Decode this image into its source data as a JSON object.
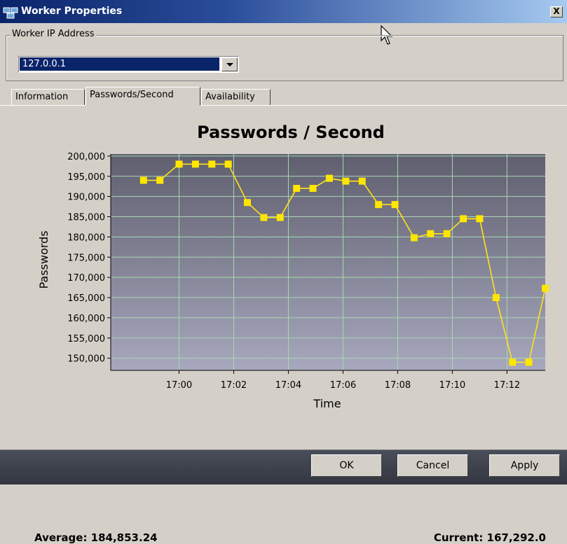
{
  "window": {
    "title": "Worker Properties",
    "close_label": "X"
  },
  "ip_group": {
    "label": "Worker IP Address",
    "selected": "127.0.0.1"
  },
  "tabs": [
    {
      "label": "Information",
      "active": false
    },
    {
      "label": "Passwords/Second",
      "active": true
    },
    {
      "label": "Availability",
      "active": false
    }
  ],
  "stats": {
    "average": "Average: 184,853.24",
    "current": "Current: 167,292.0"
  },
  "buttons": {
    "ok": "OK",
    "cancel": "Cancel",
    "apply": "Apply"
  },
  "colors": {
    "line": "#ffe21a",
    "marker": "#ffe600",
    "grid": "#a8d8b0",
    "plot_top": "#5f5f6f",
    "plot_bottom": "#a7a7bd"
  },
  "chart_data": {
    "type": "line",
    "title": "Passwords / Second",
    "xlabel": "Time",
    "ylabel": "Passwords",
    "ylim": [
      147000,
      200500
    ],
    "y_ticks": [
      "150,000",
      "155,000",
      "160,000",
      "165,000",
      "170,000",
      "175,000",
      "180,000",
      "185,000",
      "190,000",
      "195,000",
      "200,000"
    ],
    "x_ticks": [
      "17:00",
      "17:02",
      "17:04",
      "17:06",
      "17:08",
      "17:10",
      "17:12"
    ],
    "series": [
      {
        "values": [
          [
            16.98,
            194000
          ],
          [
            16.98,
            194000
          ]
        ]
      }
    ],
    "x": [
      "16:58.7",
      "16:59.3",
      "17:00.0",
      "17:00.6",
      "17:01.2",
      "17:01.8",
      "17:02.5",
      "17:03.1",
      "17:03.7",
      "17:04.3",
      "17:04.9",
      "17:05.5",
      "17:06.1",
      "17:06.7",
      "17:07.3",
      "17:07.9",
      "17:08.6",
      "17:09.2",
      "17:09.8",
      "17:10.4",
      "17:11.0",
      "17:11.6",
      "17:12.2",
      "17:12.8",
      "17:13.4"
    ],
    "y": [
      194000,
      194000,
      198000,
      198000,
      198000,
      198000,
      188500,
      184800,
      184800,
      192000,
      192000,
      194500,
      193800,
      193800,
      188000,
      188000,
      179800,
      180800,
      180800,
      184500,
      184500,
      165000,
      149000,
      149000,
      167300
    ]
  }
}
